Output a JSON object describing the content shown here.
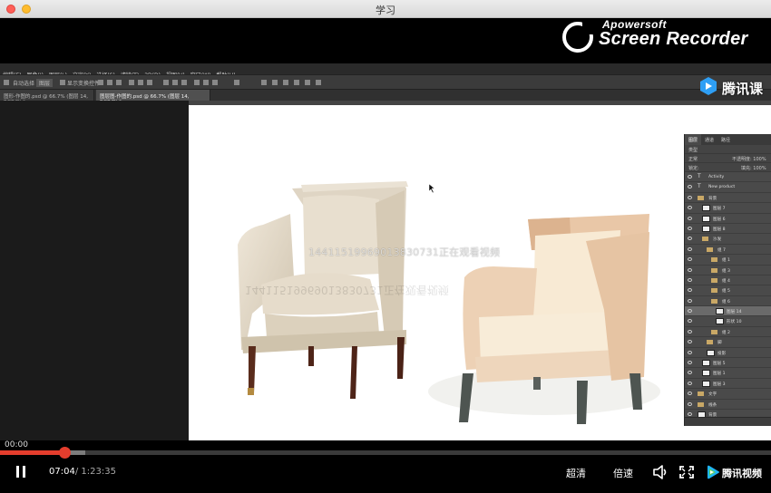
{
  "window": {
    "title": "学习"
  },
  "recorder_watermark": {
    "brand": "Apowersoft",
    "product": "Screen Recorder"
  },
  "tencent_logo": {
    "text": "腾讯课"
  },
  "photoshop": {
    "menu": [
      "编辑(E)",
      "图像(I)",
      "图层(L)",
      "文字(Y)",
      "选择(S)",
      "滤镜(T)",
      "3D(D)",
      "视图(V)",
      "窗口(W)",
      "帮助(H)"
    ],
    "options": {
      "auto_select": "自动选择",
      "group": "图层",
      "transform": "显示变换控件"
    },
    "tabs": [
      {
        "label": "图形-作图的.psd @ 66.7% (图层 14, RGB/8) *",
        "active": false
      },
      {
        "label": "图层图-作图的.psd @ 66.7% (图层 14, RGB/8) *",
        "active": true
      }
    ],
    "canvas_watermark": "14411519969013830731正在观看视频",
    "canvas_watermark_mirror": "14411519969013830731正在观看视频"
  },
  "layers_panel": {
    "tabs": [
      "图层",
      "通道",
      "路径"
    ],
    "filter_label": "类型",
    "blend_mode": "正常",
    "opacity_label": "不透明度: 100%",
    "lock_label": "锁定:",
    "fill_label": "填充: 100%",
    "layers": [
      {
        "name": "Activity",
        "kind": "text",
        "indent": 0,
        "selected": false
      },
      {
        "name": "New product",
        "kind": "text",
        "indent": 0,
        "selected": false
      },
      {
        "name": "背景",
        "kind": "folder",
        "indent": 0,
        "selected": false
      },
      {
        "name": "图层 7",
        "kind": "thumb",
        "indent": 1,
        "selected": false
      },
      {
        "name": "图层 6",
        "kind": "thumb",
        "indent": 1,
        "selected": false
      },
      {
        "name": "图层 8",
        "kind": "thumb",
        "indent": 1,
        "selected": false
      },
      {
        "name": "沙发",
        "kind": "folder",
        "indent": 1,
        "selected": false
      },
      {
        "name": "组 7",
        "kind": "folder",
        "indent": 2,
        "selected": false
      },
      {
        "name": "组 1",
        "kind": "folder",
        "indent": 3,
        "selected": false
      },
      {
        "name": "组 3",
        "kind": "folder",
        "indent": 3,
        "selected": false
      },
      {
        "name": "组 4",
        "kind": "folder",
        "indent": 3,
        "selected": false
      },
      {
        "name": "组 5",
        "kind": "folder",
        "indent": 3,
        "selected": false
      },
      {
        "name": "组 6",
        "kind": "folder",
        "indent": 3,
        "selected": false
      },
      {
        "name": "图层 14",
        "kind": "thumb",
        "indent": 4,
        "selected": true
      },
      {
        "name": "形状 10",
        "kind": "thumb",
        "indent": 4,
        "selected": false
      },
      {
        "name": "组 2",
        "kind": "folder",
        "indent": 3,
        "selected": false
      },
      {
        "name": "脚",
        "kind": "folder",
        "indent": 2,
        "selected": false
      },
      {
        "name": "投影",
        "kind": "thumb",
        "indent": 2,
        "selected": false
      },
      {
        "name": "图层 5",
        "kind": "thumb",
        "indent": 1,
        "selected": false
      },
      {
        "name": "图层 1",
        "kind": "thumb",
        "indent": 1,
        "selected": false
      },
      {
        "name": "图层 3",
        "kind": "thumb",
        "indent": 1,
        "selected": false
      },
      {
        "name": "文字",
        "kind": "folder",
        "indent": 0,
        "selected": false
      },
      {
        "name": "线条",
        "kind": "folder",
        "indent": 0,
        "selected": false
      },
      {
        "name": "背景",
        "kind": "thumb",
        "indent": 0,
        "selected": false
      }
    ]
  },
  "player": {
    "elapsed_hover": "00:00",
    "current_time": "07:04",
    "total_time": "/ 1:23:35",
    "progress": 0.084,
    "buffered": 0.111,
    "quality_label": "超清",
    "speed_label": "倍速",
    "brand": "腾讯视频",
    "colors": {
      "accent": "#e43d2d"
    }
  }
}
